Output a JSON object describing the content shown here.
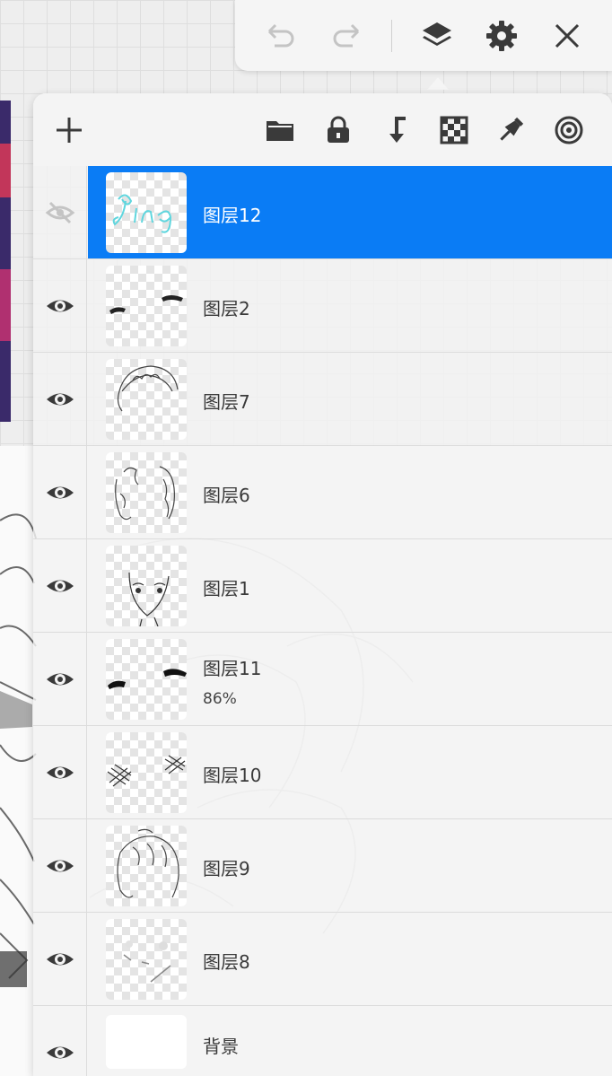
{
  "toolbar": {
    "undo_icon": "undo-icon",
    "redo_icon": "redo-icon",
    "layers_icon": "layers-icon",
    "settings_icon": "gear-icon",
    "close_icon": "close-icon"
  },
  "panel_toolbar": {
    "add_icon": "plus-icon",
    "folder_icon": "folder-icon",
    "lock_icon": "lock-icon",
    "merge_down_icon": "merge-down-icon",
    "transparency_icon": "checkerboard-icon",
    "pin_icon": "pin-icon",
    "target_icon": "target-icon"
  },
  "colors": {
    "selected_row": "#0a7cf5",
    "panel_bg": "#f3f3f3",
    "icon_dark": "#3a3a3a",
    "icon_muted": "#bdbdbd"
  },
  "layers": [
    {
      "name": "图层12",
      "selected": true,
      "visible": false,
      "thumb": "teal-handwriting"
    },
    {
      "name": "图层2",
      "selected": false,
      "visible": true,
      "thumb": "eye-lashes"
    },
    {
      "name": "图层7",
      "selected": false,
      "visible": true,
      "thumb": "hair-top"
    },
    {
      "name": "图层6",
      "selected": false,
      "visible": true,
      "thumb": "hair-curls"
    },
    {
      "name": "图层1",
      "selected": false,
      "visible": true,
      "thumb": "face-sketch"
    },
    {
      "name": "图层11",
      "opacity": "86%",
      "selected": false,
      "visible": true,
      "thumb": "dark-lashes"
    },
    {
      "name": "图层10",
      "selected": false,
      "visible": true,
      "thumb": "cross-hatch"
    },
    {
      "name": "图层9",
      "selected": false,
      "visible": true,
      "thumb": "hair-outline"
    },
    {
      "name": "图层8",
      "selected": false,
      "visible": true,
      "thumb": "faint-strokes"
    },
    {
      "name": "背景",
      "selected": false,
      "visible": true,
      "thumb": "white"
    }
  ]
}
